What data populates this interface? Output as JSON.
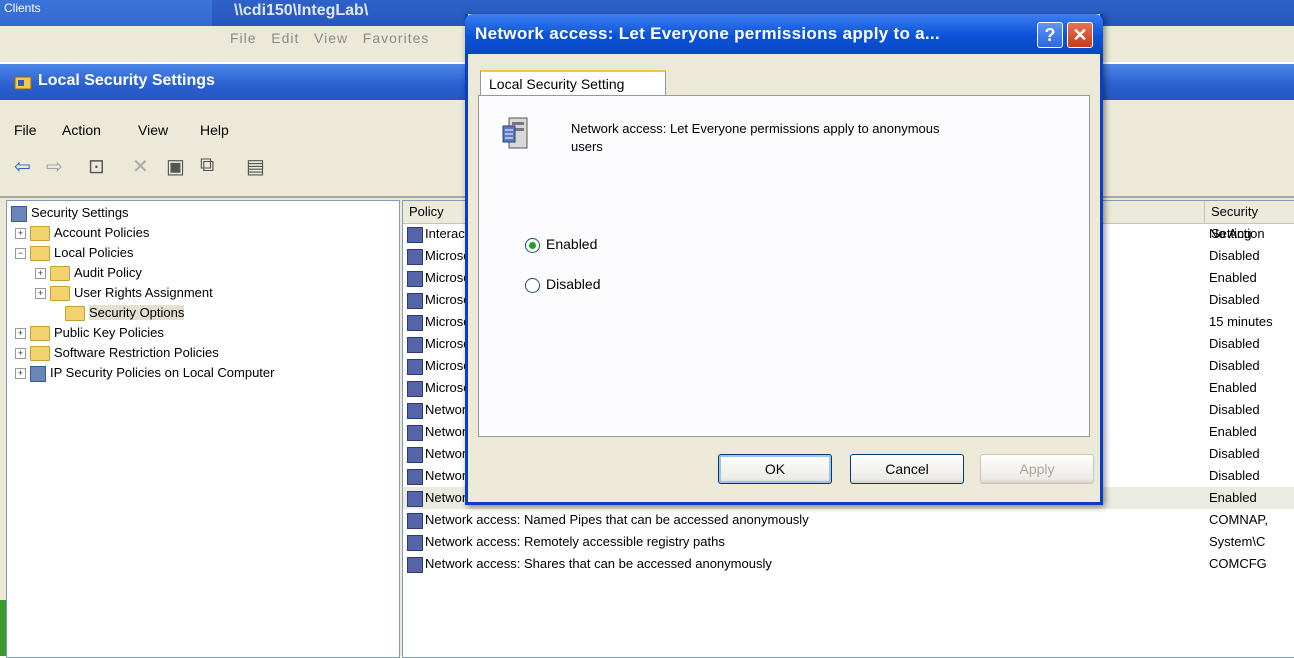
{
  "background": {
    "clients_text": "Clients",
    "path_text": "\\\\cdi150\\IntegLab\\",
    "menu_ghost": [
      "File",
      "Edit",
      "View",
      "Favorites"
    ]
  },
  "mmc": {
    "title": "Local Security Settings",
    "menu": [
      "File",
      "Action",
      "View",
      "Help"
    ],
    "tree": {
      "root": "Security Settings",
      "nodes": [
        {
          "label": "Account Policies",
          "expander": "+"
        },
        {
          "label": "Local Policies",
          "expander": "−"
        },
        {
          "label": "Audit Policy",
          "expander": "+"
        },
        {
          "label": "User Rights Assignment",
          "expander": "+"
        },
        {
          "label": "Security Options",
          "expander": ""
        },
        {
          "label": "Public Key Policies",
          "expander": "+"
        },
        {
          "label": "Software Restriction Policies",
          "expander": "+"
        },
        {
          "label": "IP Security Policies on Local Computer",
          "expander": "+"
        }
      ]
    },
    "list": {
      "columns": [
        "Policy",
        "Security Setting"
      ],
      "rows": [
        {
          "policy": "Interactive logon: Message text for users attempting to log on",
          "setting": "No Action"
        },
        {
          "policy": "Microsoft network client: Digitally sign communications (always)",
          "setting": "Disabled"
        },
        {
          "policy": "Microsoft network client: Digitally sign communications (if server agrees)",
          "setting": "Enabled"
        },
        {
          "policy": "Microsoft network client: Send unencrypted password to third-party SMB servers",
          "setting": "Disabled"
        },
        {
          "policy": "Microsoft network server: Amount of idle time required before suspending session",
          "setting": "15 minutes"
        },
        {
          "policy": "Microsoft network server: Digitally sign communications (always)",
          "setting": "Disabled"
        },
        {
          "policy": "Microsoft network server: Digitally sign communications (if client agrees)",
          "setting": "Disabled"
        },
        {
          "policy": "Microsoft network server: Disconnect clients when logon hours expire",
          "setting": "Enabled"
        },
        {
          "policy": "Network access: Allow anonymous SID/Name translation",
          "setting": "Disabled"
        },
        {
          "policy": "Network access: Do not allow anonymous enumeration of SAM accounts",
          "setting": "Enabled"
        },
        {
          "policy": "Network access: Do not allow anonymous enumeration of SAM accounts and shares",
          "setting": "Disabled"
        },
        {
          "policy": "Network access: Do not allow storage of credentials or .NET Passports for network authentication",
          "setting": "Disabled"
        },
        {
          "policy": "Network access: Let Everyone permissions apply to anonymous users",
          "setting": "Enabled"
        },
        {
          "policy": "Network access: Named Pipes that can be accessed anonymously",
          "setting": "COMNAP,"
        },
        {
          "policy": "Network access: Remotely accessible registry paths",
          "setting": "System\\C"
        },
        {
          "policy": "Network access: Shares that can be accessed anonymously",
          "setting": "COMCFG"
        }
      ]
    }
  },
  "dialog": {
    "title": "Network access: Let Everyone permissions apply to a...",
    "help_glyph": "?",
    "close_glyph": "✕",
    "tab_label": "Local Security Setting",
    "policy_text": "Network access: Let Everyone permissions apply to anonymous users",
    "options": [
      {
        "label": "Enabled",
        "selected": true
      },
      {
        "label": "Disabled",
        "selected": false
      }
    ],
    "buttons": {
      "ok": "OK",
      "cancel": "Cancel",
      "apply": "Apply"
    }
  }
}
